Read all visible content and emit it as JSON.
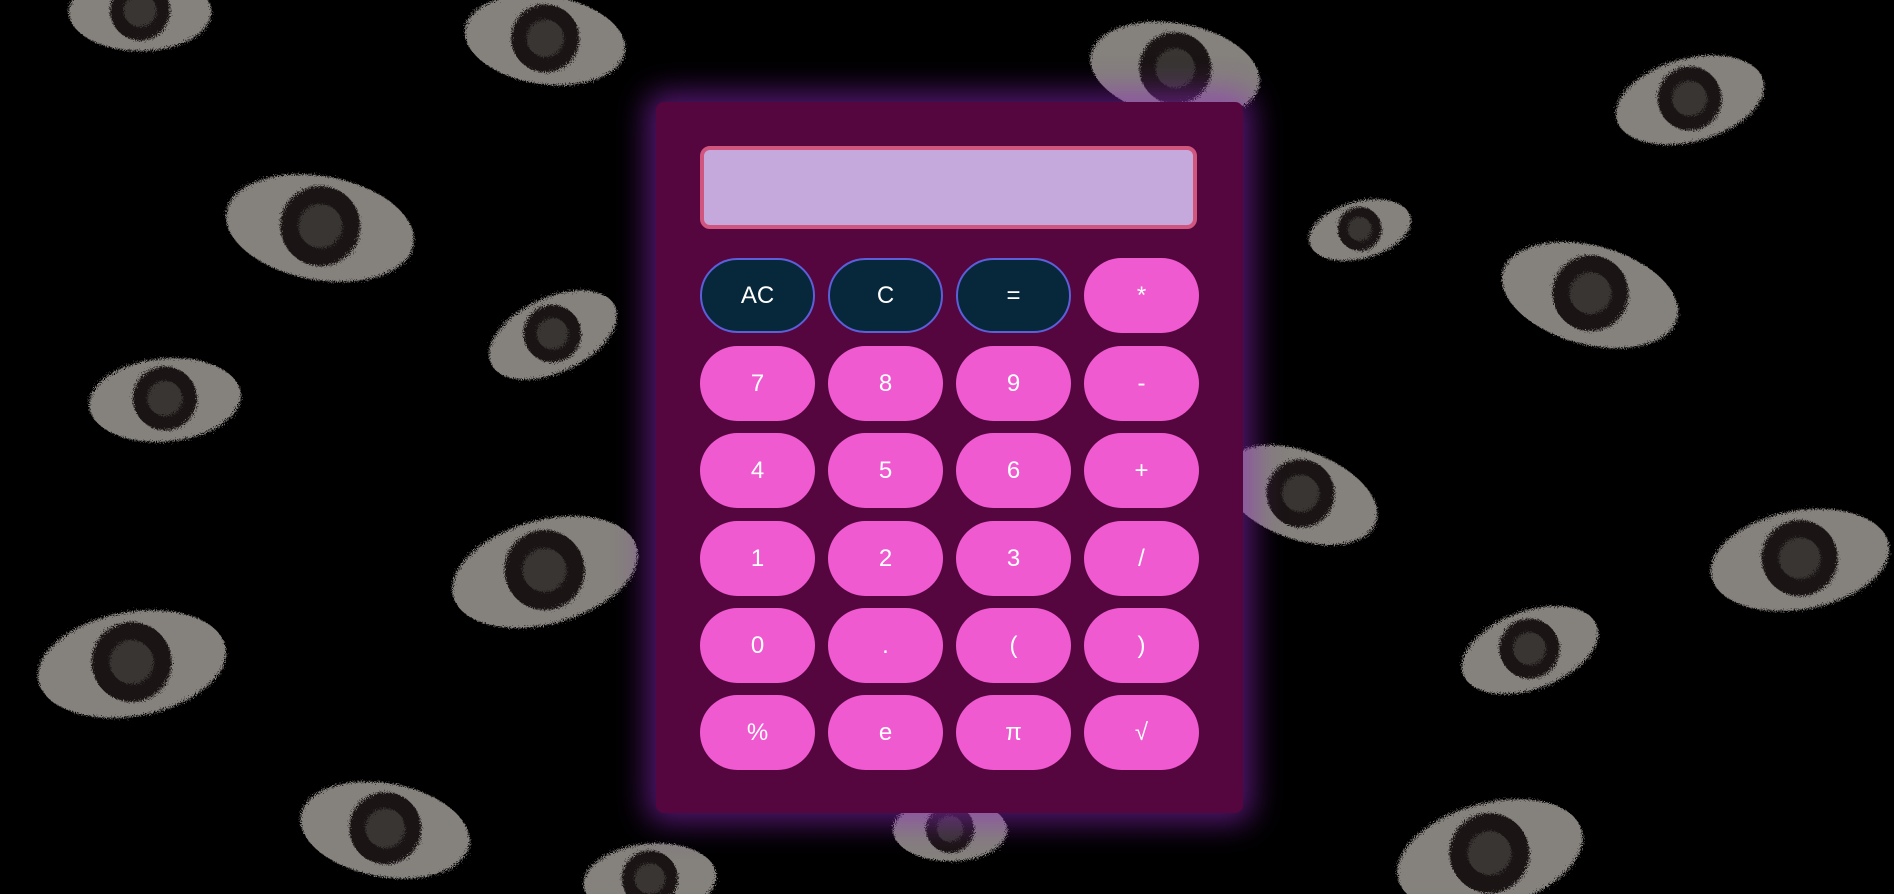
{
  "display": {
    "value": ""
  },
  "buttons": {
    "ac": "AC",
    "c": "C",
    "equals": "=",
    "multiply": "*",
    "seven": "7",
    "eight": "8",
    "nine": "9",
    "minus": "-",
    "four": "4",
    "five": "5",
    "six": "6",
    "plus": "+",
    "one": "1",
    "two": "2",
    "three": "3",
    "divide": "/",
    "zero": "0",
    "dot": ".",
    "lparen": "(",
    "rparen": ")",
    "percent": "%",
    "e": "e",
    "pi": "π",
    "sqrt": "√"
  },
  "colors": {
    "page_background": "#000000",
    "calculator_body": "#55063f",
    "display_background": "#c6a9dc",
    "display_border": "#d1567f",
    "button_pink": "#ef5ad1",
    "button_dark": "#07273a",
    "button_dark_border": "#5b5fd9",
    "glow": "#9628c8"
  },
  "background_pattern": {
    "icon": "eye-icon"
  }
}
